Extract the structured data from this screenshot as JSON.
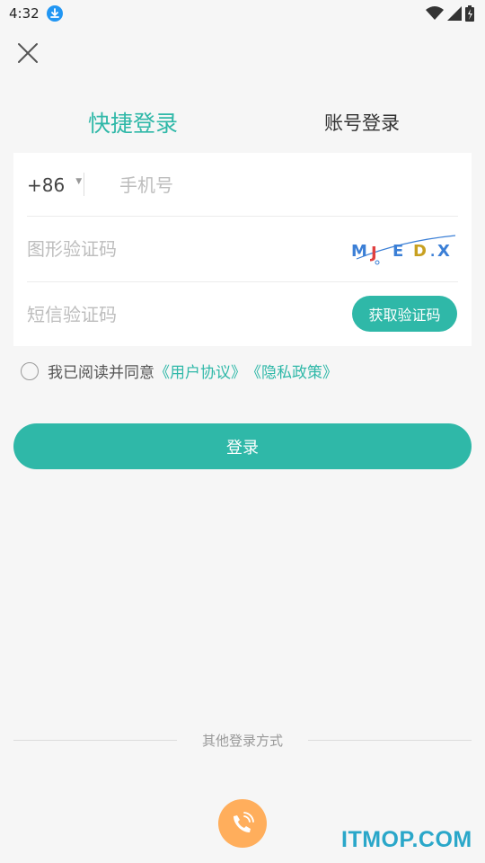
{
  "status_bar": {
    "time": "4:32",
    "icons": [
      "download-icon",
      "wifi-icon",
      "signal-icon",
      "battery-icon"
    ]
  },
  "header": {
    "close_icon": "close-icon"
  },
  "tabs": {
    "quick_login": "快捷登录",
    "account_login": "账号登录"
  },
  "form": {
    "country_code": "+86",
    "phone_placeholder": "手机号",
    "captcha_placeholder": "图形验证码",
    "captcha_text": "MJED.X",
    "sms_placeholder": "短信验证码",
    "sms_button": "获取验证码"
  },
  "agreement": {
    "text": "我已阅读并同意",
    "user_agreement": "《用户协议》",
    "privacy_policy": "《隐私政策》"
  },
  "login_button": "登录",
  "other_login": {
    "label": "其他登录方式",
    "phone_icon": "phone-icon"
  },
  "watermark": "ITMOP.COM",
  "colors": {
    "accent": "#2fb8a8",
    "phone_button": "#ffae5c",
    "watermark": "#2aa7c9"
  }
}
